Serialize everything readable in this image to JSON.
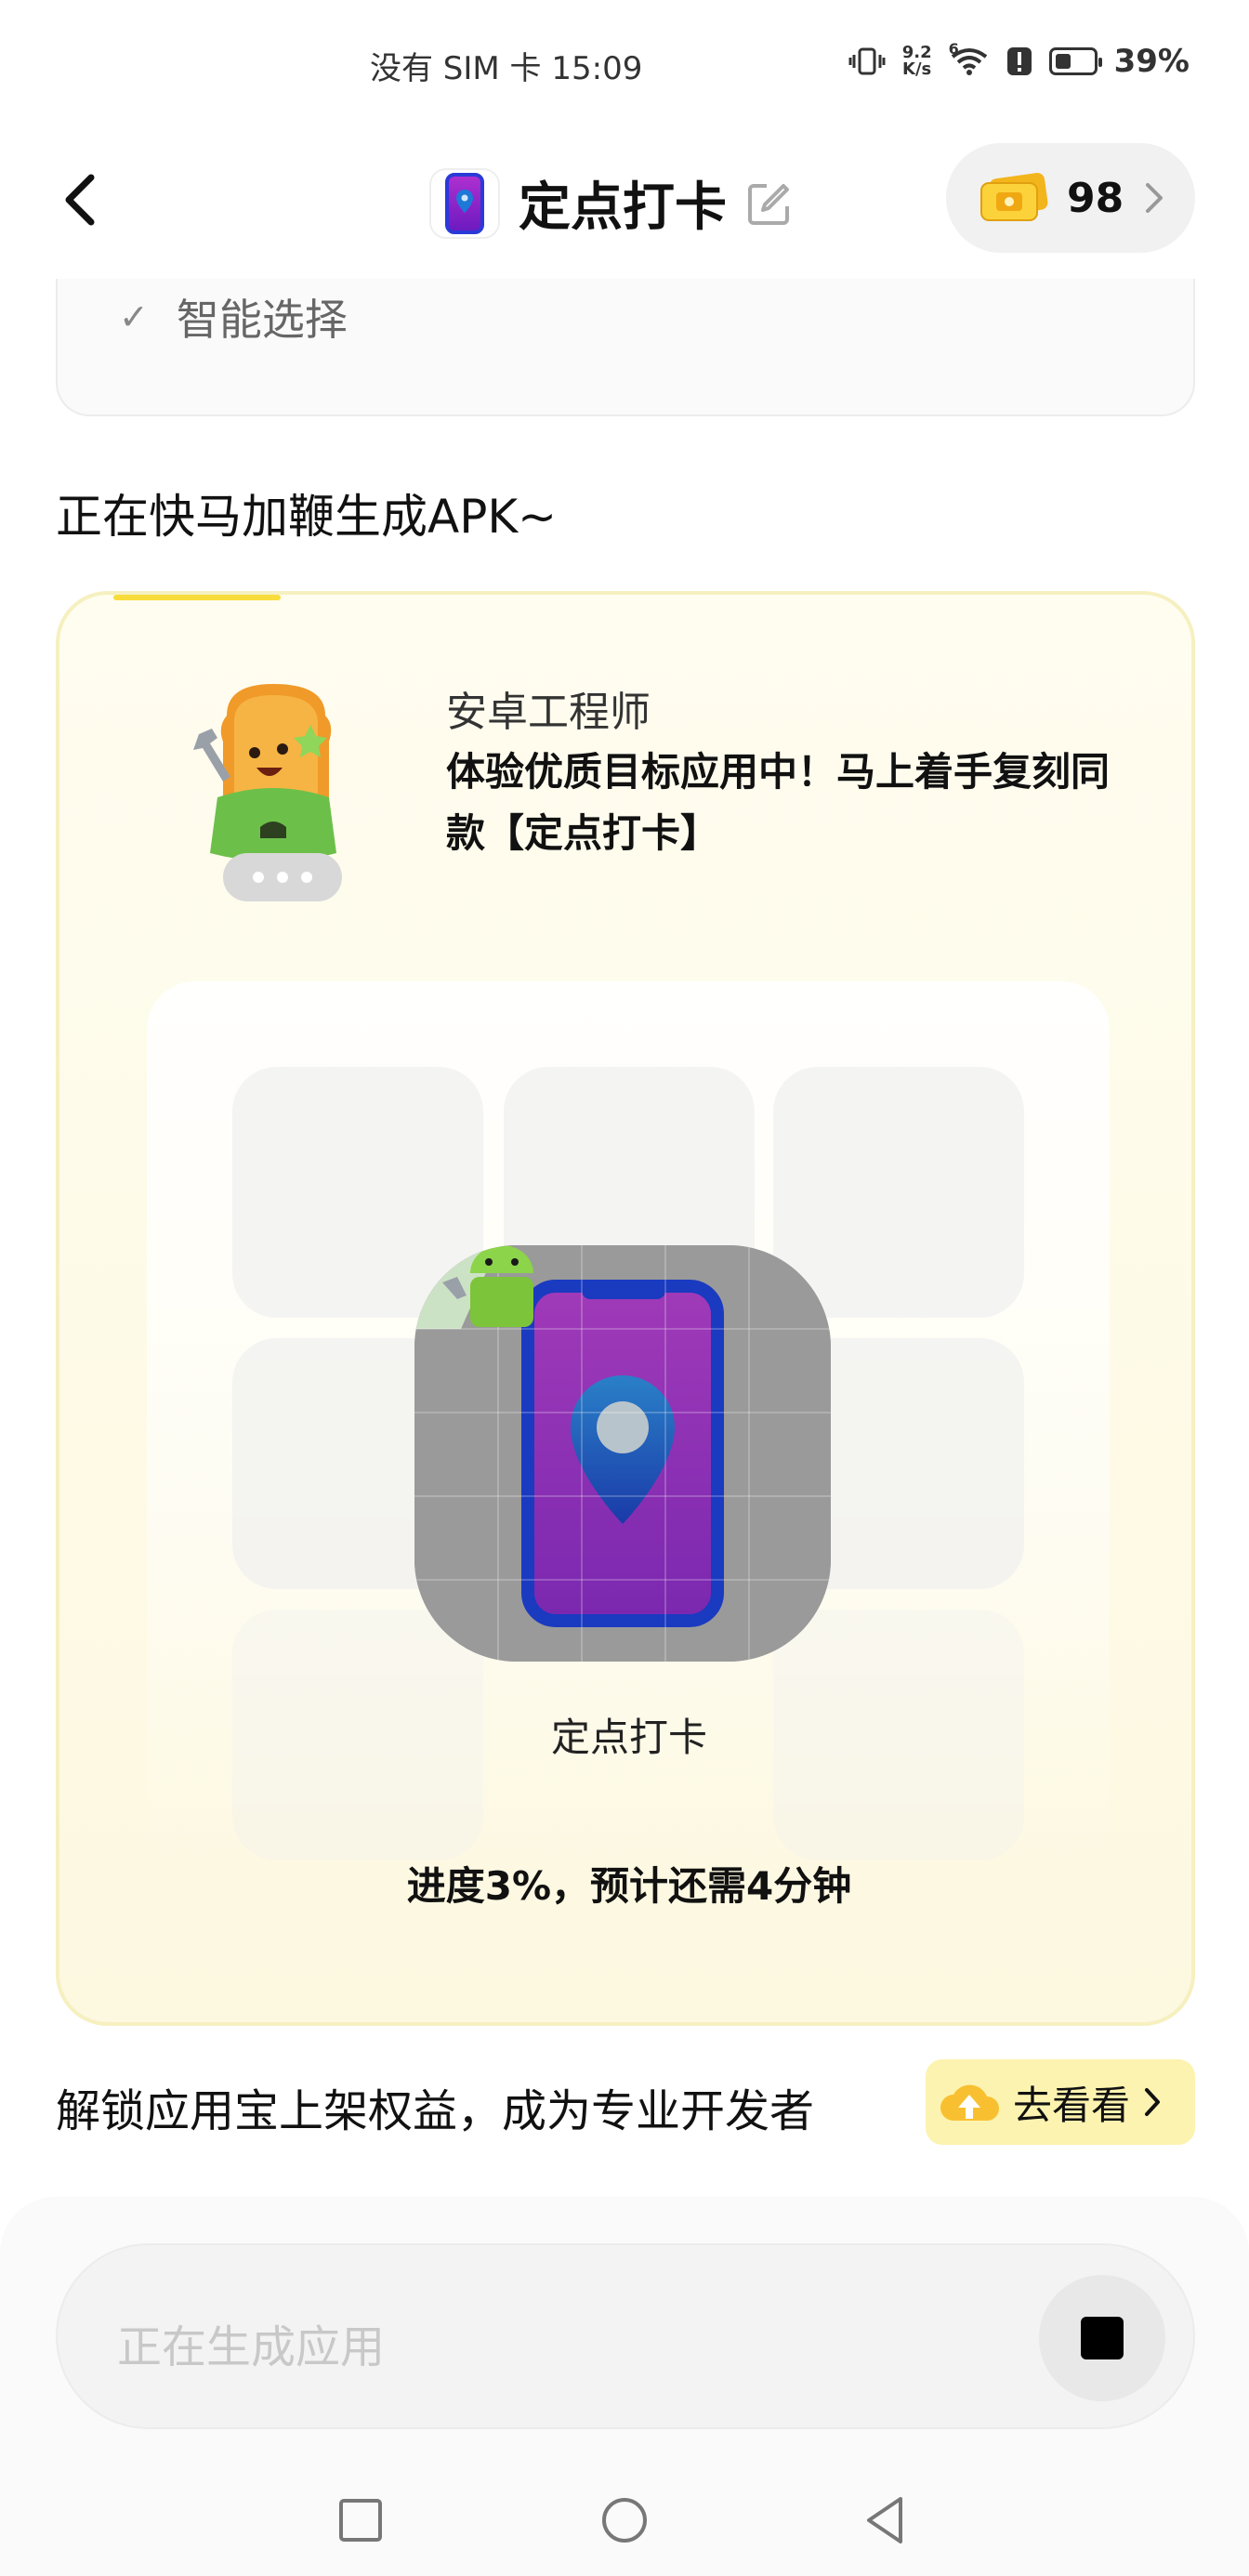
{
  "status_bar": {
    "carrier_time": "没有 SIM 卡 15:09",
    "net_speed_value": "9.2",
    "net_speed_unit": "K/s",
    "wifi_badge": "6",
    "battery": "39%",
    "battery_level": 0.39,
    "icons": [
      "vibrate-icon",
      "wifi-icon",
      "alert-icon",
      "battery-icon"
    ]
  },
  "header": {
    "title": "定点打卡",
    "coin_count": "98",
    "icons": [
      "back-arrow-icon",
      "location-phone-app-icon",
      "edit-icon",
      "coin-ticket-icon",
      "chevron-right-icon"
    ]
  },
  "smart_select": {
    "label": "智能选择"
  },
  "generation": {
    "heading": "正在快马加鞭生成APK~",
    "engineer_name": "安卓工程师",
    "engineer_message": "体验优质目标应用中！马上着手复刻同款【定点打卡】",
    "app_name": "定点打卡",
    "progress_text": "进度3%，预计还需4分钟",
    "progress_percent": 3
  },
  "unlock": {
    "text": "解锁应用宝上架权益，成为专业开发者",
    "button_label": "去看看"
  },
  "input": {
    "placeholder": "正在生成应用"
  },
  "colors": {
    "accent_yellow": "#f8dc3c",
    "card_border": "#f6f0c0",
    "go_button_bg": "#fdf3b0",
    "app_icon_purple": "#8a2aa8",
    "app_icon_blue": "#1a40c8"
  }
}
